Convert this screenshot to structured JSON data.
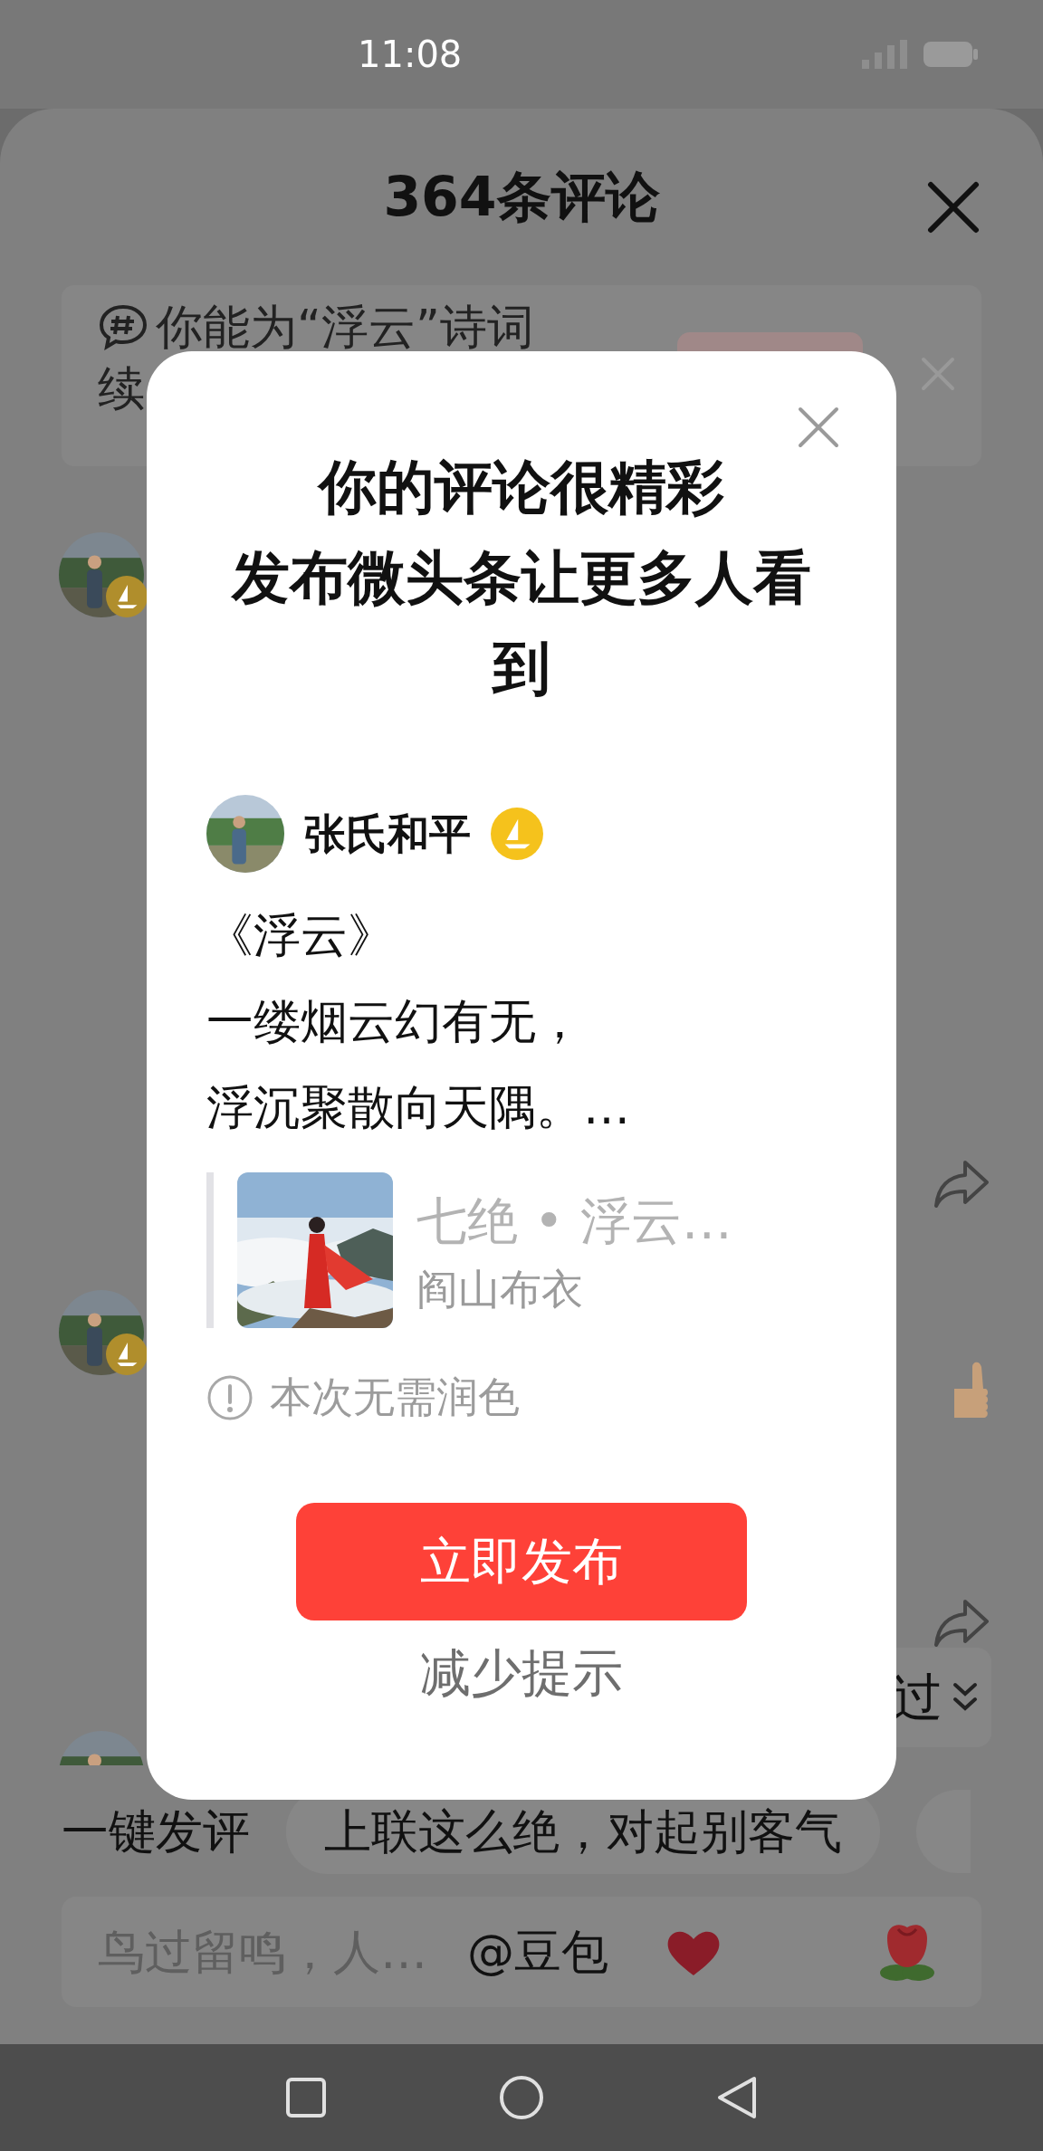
{
  "status_bar": {
    "time": "11:08"
  },
  "sheet": {
    "title": "364条评论"
  },
  "topic_banner": {
    "text_lines": [
      "你能为“浮云”诗词",
      "续"
    ]
  },
  "comments": [
    {
      "badge": true,
      "share": true,
      "thumb": false
    },
    {
      "badge": true,
      "share": true,
      "thumb": true
    },
    {
      "badge": false,
      "share": false,
      "thumb": false
    }
  ],
  "scroll_chip": {
    "text": "过"
  },
  "quick_comments": {
    "label": "一键发评",
    "chips": [
      "上联这么绝，对起别客气"
    ]
  },
  "input": {
    "placeholder": "鸟过留鸣，人…",
    "mention": "@豆包"
  },
  "modal": {
    "title_lines": [
      "你的评论很精彩",
      "发布微头条让更多人看到"
    ],
    "author": {
      "name": "张氏和平",
      "badge": true
    },
    "poem_lines": [
      "《浮云》",
      "一缕烟云幻有无，",
      "浮沉聚散向天隅。…"
    ],
    "quote": {
      "title": "七绝 • 浮云…",
      "author": "阎山布衣"
    },
    "hint": "本次无需润色",
    "primary_button": "立即发布",
    "secondary_button": "减少提示"
  }
}
